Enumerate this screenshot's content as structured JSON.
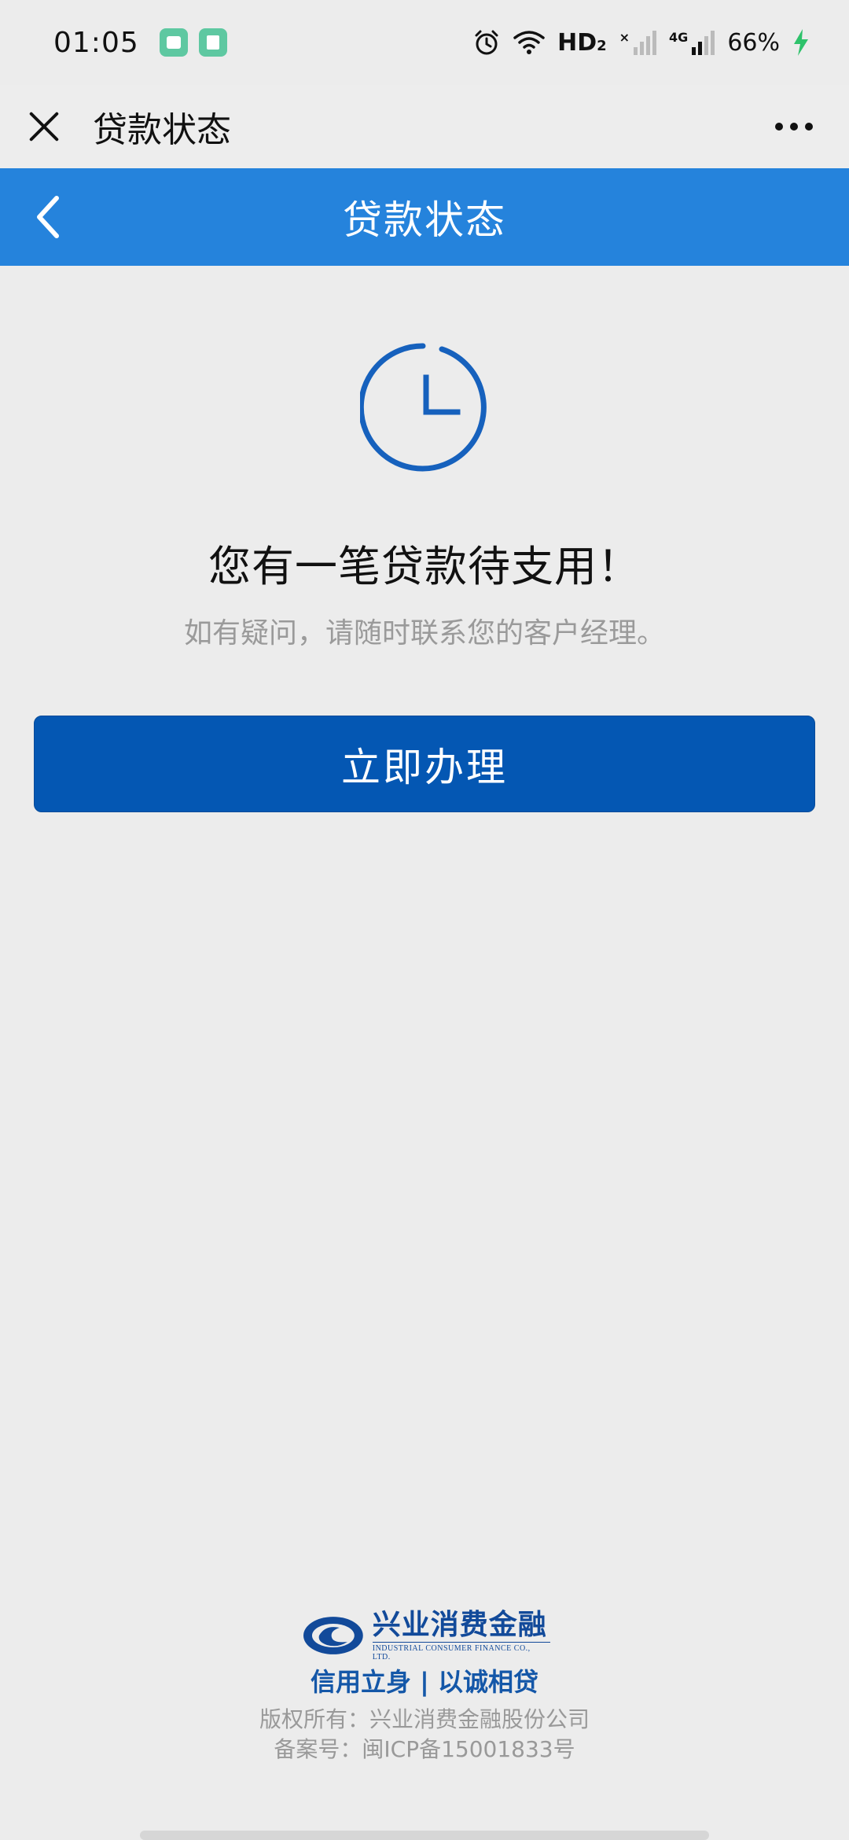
{
  "status_bar": {
    "time": "01:05",
    "network_label": "HD",
    "network_sub": "2",
    "signal2_label": "4G",
    "battery": "66%"
  },
  "title_bar": {
    "title": "贷款状态"
  },
  "nav_header": {
    "title": "贷款状态"
  },
  "main": {
    "headline": "您有一笔贷款待支用！",
    "subline": "如有疑问，请随时联系您的客户经理。",
    "action_label": "立即办理"
  },
  "footer": {
    "logo_cn": "兴业消费金融",
    "logo_en": "INDUSTRIAL CONSUMER FINANCE CO., LTD.",
    "slogan": "信用立身 | 以诚相贷",
    "copyright": "版权所有：兴业消费金融股份公司",
    "icp": "备案号：闽ICP备15001833号"
  },
  "colors": {
    "header_blue": "#2583dc",
    "button_blue": "#0457b3",
    "brand_blue": "#124a9a"
  }
}
